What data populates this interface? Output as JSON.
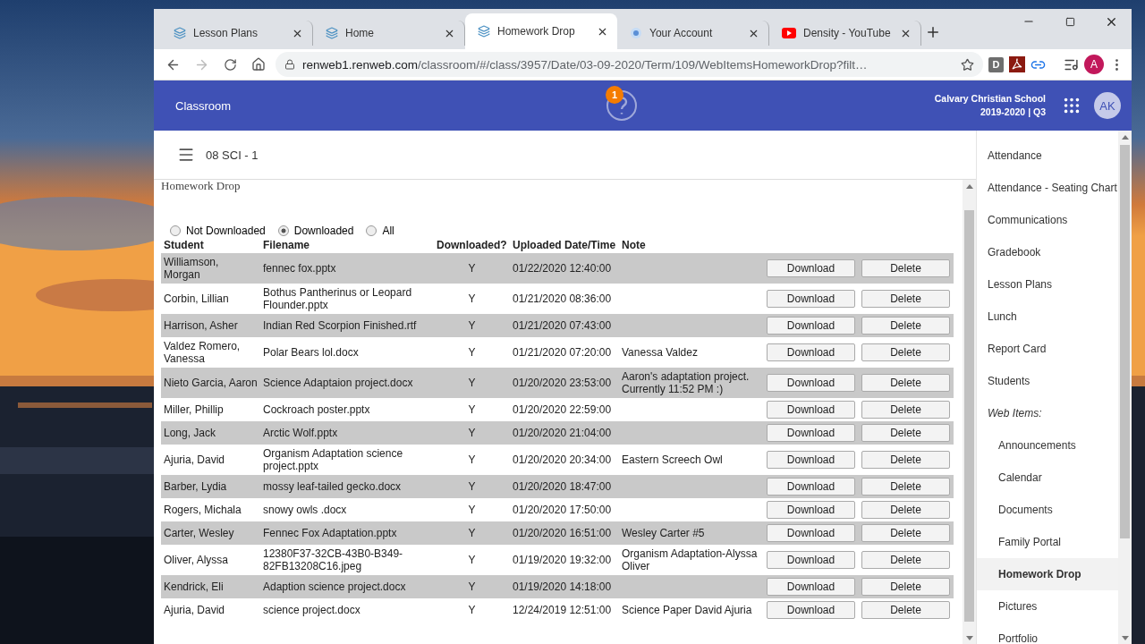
{
  "browser": {
    "tabs": [
      {
        "title": "Lesson Plans",
        "kind": "layers",
        "selected": false
      },
      {
        "title": "Home",
        "kind": "layers",
        "selected": false
      },
      {
        "title": "Homework Drop",
        "kind": "layers",
        "selected": true
      },
      {
        "title": "Your Account",
        "kind": "circle",
        "selected": false
      },
      {
        "title": "Density - YouTube",
        "kind": "youtube",
        "selected": false
      }
    ],
    "url_host": "renweb1.renweb.com",
    "url_path": "/classroom/#/class/3957/Date/03-09-2020/Term/109/WebItemsHomeworkDrop?filt…",
    "extension_letter": "D",
    "profile_initial": "A"
  },
  "header": {
    "title": "Classroom",
    "notification_count": "1",
    "school": "Calvary Christian School",
    "term": "2019-2020 | Q3",
    "avatar": "AK"
  },
  "class_title": "08 SCI - 1",
  "page_heading": "Homework Drop",
  "filters": [
    {
      "label": "Not Downloaded",
      "selected": false
    },
    {
      "label": "Downloaded",
      "selected": true
    },
    {
      "label": "All",
      "selected": false
    }
  ],
  "table": {
    "columns": [
      "Student",
      "Filename",
      "Downloaded?",
      "Uploaded Date/Time",
      "Note"
    ],
    "rows": [
      {
        "student": "Williamson, Morgan",
        "filename": "fennec fox.pptx",
        "downloaded": "Y",
        "uploaded": "01/22/2020 12:40:00",
        "note": "",
        "actions": [
          "Download",
          "Delete"
        ]
      },
      {
        "student": "Corbin, Lillian",
        "filename": "Bothus Pantherinus or Leopard Flounder.pptx",
        "downloaded": "Y",
        "uploaded": "01/21/2020 08:36:00",
        "note": "",
        "actions": [
          "Download",
          "Delete"
        ]
      },
      {
        "student": "Harrison, Asher",
        "filename": "Indian Red Scorpion Finished.rtf",
        "downloaded": "Y",
        "uploaded": "01/21/2020 07:43:00",
        "note": "",
        "actions": [
          "Download",
          "Delete"
        ]
      },
      {
        "student": "Valdez Romero, Vanessa",
        "filename": "Polar Bears lol.docx",
        "downloaded": "Y",
        "uploaded": "01/21/2020 07:20:00",
        "note": "Vanessa Valdez",
        "actions": [
          "Download",
          "Delete"
        ]
      },
      {
        "student": "Nieto Garcia, Aaron",
        "filename": "Science Adaptaion project.docx",
        "downloaded": "Y",
        "uploaded": "01/20/2020 23:53:00",
        "note": "Aaron's adaptation project. Currently 11:52 PM :)",
        "actions": [
          "Download",
          "Delete"
        ]
      },
      {
        "student": "Miller, Phillip",
        "filename": "Cockroach poster.pptx",
        "downloaded": "Y",
        "uploaded": "01/20/2020 22:59:00",
        "note": "",
        "actions": [
          "Download",
          "Delete"
        ]
      },
      {
        "student": "Long, Jack",
        "filename": "Arctic Wolf.pptx",
        "downloaded": "Y",
        "uploaded": "01/20/2020 21:04:00",
        "note": "",
        "actions": [
          "Download",
          "Delete"
        ]
      },
      {
        "student": "Ajuria, David",
        "filename": "Organism Adaptation science project.pptx",
        "downloaded": "Y",
        "uploaded": "01/20/2020 20:34:00",
        "note": "Eastern Screech Owl",
        "actions": [
          "Download",
          "Delete"
        ]
      },
      {
        "student": "Barber, Lydia",
        "filename": "mossy leaf-tailed gecko.docx",
        "downloaded": "Y",
        "uploaded": "01/20/2020 18:47:00",
        "note": "",
        "actions": [
          "Download",
          "Delete"
        ]
      },
      {
        "student": "Rogers, Michala",
        "filename": "snowy owls .docx",
        "downloaded": "Y",
        "uploaded": "01/20/2020 17:50:00",
        "note": "",
        "actions": [
          "Download",
          "Delete"
        ]
      },
      {
        "student": "Carter, Wesley",
        "filename": "Fennec Fox Adaptation.pptx",
        "downloaded": "Y",
        "uploaded": "01/20/2020 16:51:00",
        "note": "Wesley Carter #5",
        "actions": [
          "Download",
          "Delete"
        ]
      },
      {
        "student": "Oliver, Alyssa",
        "filename": "12380F37-32CB-43B0-B349-82FB13208C16.jpeg",
        "downloaded": "Y",
        "uploaded": "01/19/2020 19:32:00",
        "note": "Organism Adaptation-Alyssa Oliver",
        "actions": [
          "Download",
          "Delete"
        ]
      },
      {
        "student": "Kendrick, Eli",
        "filename": "Adaption science project.docx",
        "downloaded": "Y",
        "uploaded": "01/19/2020 14:18:00",
        "note": "",
        "actions": [
          "Download",
          "Delete"
        ]
      },
      {
        "student": "Ajuria, David",
        "filename": "science project.docx",
        "downloaded": "Y",
        "uploaded": "12/24/2019 12:51:00",
        "note": "Science Paper David Ajuria",
        "actions": [
          "Download",
          "Delete"
        ]
      }
    ]
  },
  "sidebar": {
    "items": [
      {
        "label": "Attendance",
        "kind": "link",
        "selected": false
      },
      {
        "label": "Attendance - Seating Chart",
        "kind": "link",
        "selected": false
      },
      {
        "label": "Communications",
        "kind": "link",
        "selected": false
      },
      {
        "label": "Gradebook",
        "kind": "link",
        "selected": false
      },
      {
        "label": "Lesson Plans",
        "kind": "link",
        "selected": false
      },
      {
        "label": "Lunch",
        "kind": "link",
        "selected": false
      },
      {
        "label": "Report Card",
        "kind": "link",
        "selected": false
      },
      {
        "label": "Students",
        "kind": "link",
        "selected": false
      },
      {
        "label": "Web Items:",
        "kind": "section",
        "children": [
          {
            "label": "Announcements",
            "selected": false
          },
          {
            "label": "Calendar",
            "selected": false
          },
          {
            "label": "Documents",
            "selected": false
          },
          {
            "label": "Family Portal",
            "selected": false
          },
          {
            "label": "Homework Drop",
            "selected": true
          },
          {
            "label": "Pictures",
            "selected": false
          },
          {
            "label": "Portfolio",
            "selected": false
          }
        ]
      }
    ]
  }
}
